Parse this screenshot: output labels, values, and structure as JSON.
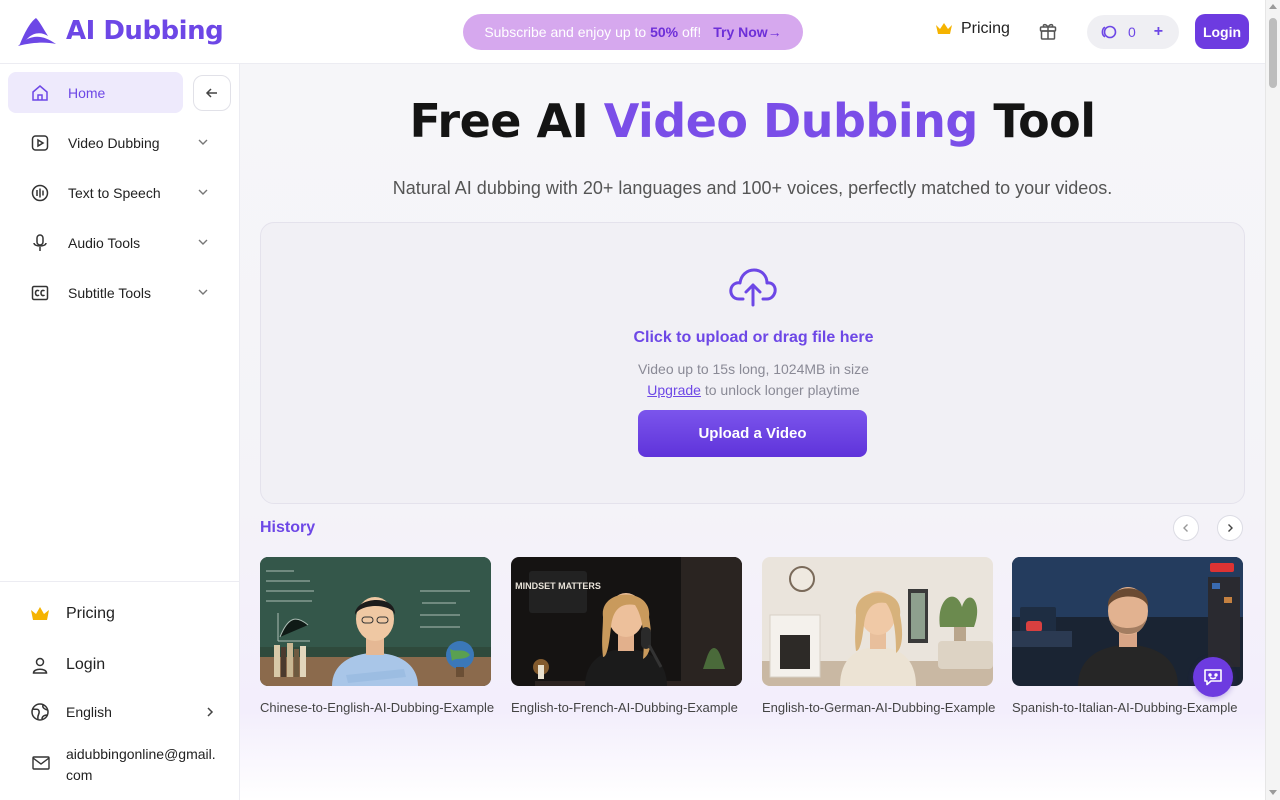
{
  "header": {
    "logo_text": "AI Dubbing",
    "promo": {
      "prefix": "Subscribe and enjoy up to",
      "highlight": "50%",
      "suffix": "off!",
      "cta": "Try Now→"
    },
    "pricing_label": "Pricing",
    "credits": {
      "count": "0",
      "plus": "+"
    },
    "login_label": "Login"
  },
  "sidebar": {
    "items": [
      {
        "label": "Home",
        "icon": "home-icon",
        "active": true
      },
      {
        "label": "Video Dubbing",
        "icon": "video-icon"
      },
      {
        "label": "Text to Speech",
        "icon": "audio-wave-icon"
      },
      {
        "label": "Audio Tools",
        "icon": "microphone-icon"
      },
      {
        "label": "Subtitle Tools",
        "icon": "cc-icon"
      }
    ],
    "bottom": {
      "pricing": "Pricing",
      "login": "Login",
      "language": "English",
      "email": "aidubbingonline@gmail.com"
    }
  },
  "hero": {
    "title_pre": "Free AI",
    "title_accent": "Video Dubbing",
    "title_post": "Tool",
    "subtitle": "Natural AI dubbing with 20+ languages and 100+ voices, perfectly matched to your videos."
  },
  "upload": {
    "cta": "Click to upload or drag file here",
    "info": "Video up to 15s long, 1024MB in size",
    "upgrade_link": "Upgrade",
    "upgrade_suffix": "to unlock longer playtime",
    "button": "Upload a Video"
  },
  "history": {
    "label": "History",
    "items": [
      {
        "title": "Chinese-to-English-AI-Dubbing-Example"
      },
      {
        "title": "English-to-French-AI-Dubbing-Example",
        "thumb_text": "MINDSET MATTERS"
      },
      {
        "title": "English-to-German-AI-Dubbing-Example"
      },
      {
        "title": "Spanish-to-Italian-AI-Dubbing-Example"
      }
    ]
  },
  "colors": {
    "accent": "#6d47e6",
    "promo_bg": "#d6a8ee",
    "active_bg": "#eeeafc"
  }
}
